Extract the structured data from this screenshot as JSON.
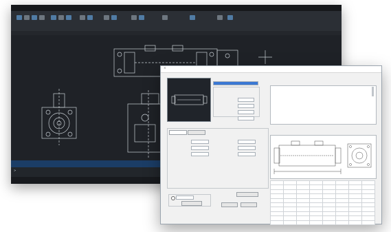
{
  "cad": {
    "window_title": "",
    "ribbon_groups": [
      "",
      "",
      "",
      "",
      "",
      ""
    ],
    "colors": {
      "background": "#1f2227",
      "lines": "#c9d0d6",
      "accent": "#5a8fc0"
    }
  },
  "dialog": {
    "title": "",
    "close_glyph": "×",
    "name_label": "",
    "name_value": "",
    "preview_caption": "",
    "fields": [
      {
        "label": "",
        "value": ""
      },
      {
        "label": "",
        "value": ""
      },
      {
        "label": "",
        "value": ""
      },
      {
        "label": "",
        "value": ""
      }
    ],
    "properties_header": "",
    "properties": [
      {
        "k": "",
        "v": ""
      },
      {
        "k": "",
        "v": ""
      },
      {
        "k": "",
        "v": ""
      },
      {
        "k": "",
        "v": ""
      },
      {
        "k": "",
        "v": ""
      },
      {
        "k": "",
        "v": ""
      },
      {
        "k": "",
        "v": ""
      },
      {
        "k": "",
        "v": ""
      },
      {
        "k": "",
        "v": ""
      }
    ],
    "tab_labels": [
      "",
      ""
    ],
    "params_left": [
      {
        "label": "",
        "value": ""
      },
      {
        "label": "",
        "value": ""
      },
      {
        "label": "",
        "value": ""
      }
    ],
    "params_right": [
      {
        "label": "",
        "value": ""
      },
      {
        "label": "",
        "value": ""
      },
      {
        "label": "",
        "value": ""
      }
    ],
    "option_group_label": "",
    "option_value": "",
    "buttons": {
      "left": "",
      "right_top": "",
      "ok": "",
      "cancel": ""
    },
    "drawing_header": "",
    "table_headers": [
      "",
      "",
      "",
      "",
      "",
      "",
      "",
      ""
    ],
    "table_rows": [
      [
        "",
        "",
        "",
        "",
        "",
        "",
        "",
        ""
      ],
      [
        "",
        "",
        "",
        "",
        "",
        "",
        "",
        ""
      ],
      [
        "",
        "",
        "",
        "",
        "",
        "",
        "",
        ""
      ],
      [
        "",
        "",
        "",
        "",
        "",
        "",
        "",
        ""
      ],
      [
        "",
        "",
        "",
        "",
        "",
        "",
        "",
        ""
      ],
      [
        "",
        "",
        "",
        "",
        "",
        "",
        "",
        ""
      ],
      [
        "",
        "",
        "",
        "",
        "",
        "",
        "",
        ""
      ],
      [
        "",
        "",
        "",
        "",
        "",
        "",
        "",
        ""
      ],
      [
        "",
        "",
        "",
        "",
        "",
        "",
        "",
        ""
      ]
    ]
  }
}
